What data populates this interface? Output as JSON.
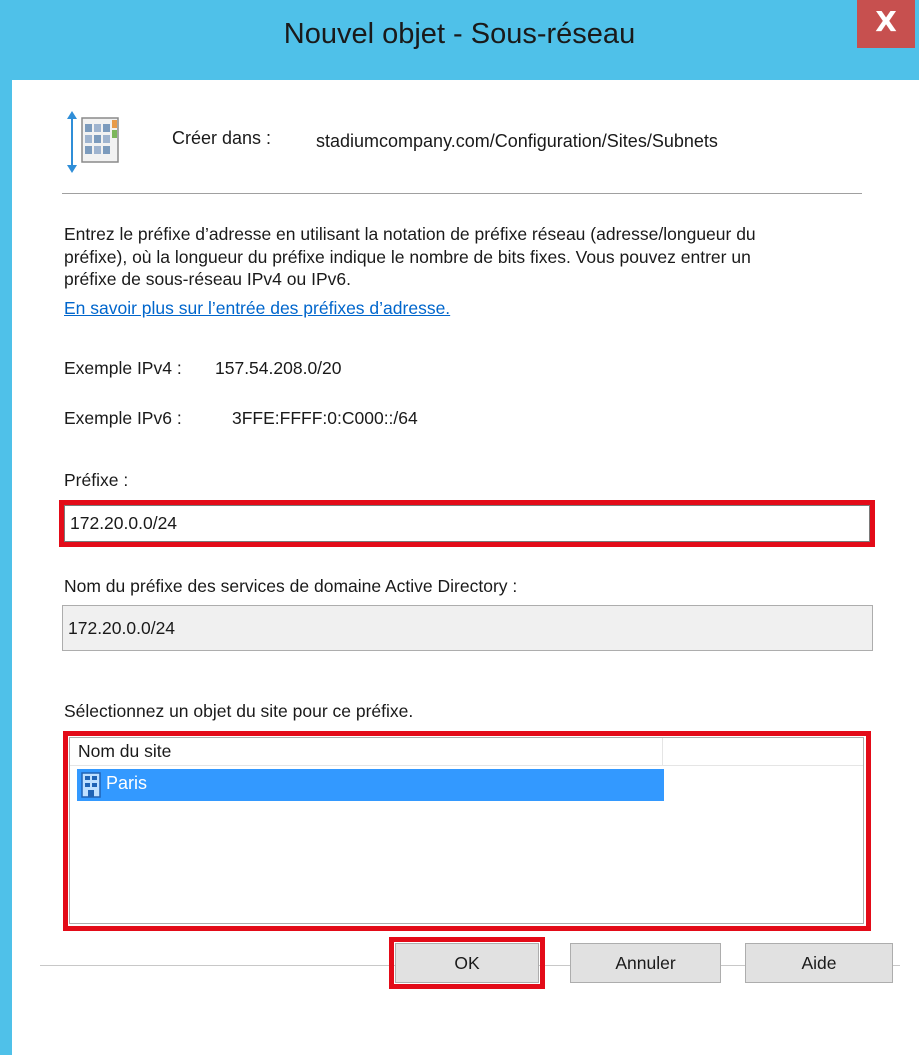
{
  "window": {
    "title": "Nouvel objet - Sous-réseau",
    "close_glyph": "X"
  },
  "header": {
    "icon": "subnet-container-icon",
    "create_label": "Créer dans :",
    "create_path": "stadiumcompany.com/Configuration/Sites/Subnets"
  },
  "description": {
    "text": "Entrez le préfixe d’adresse en utilisant la notation de préfixe réseau (adresse/longueur du préfixe), où la longueur du préfixe indique le nombre de bits fixes. Vous pouvez entrer un préfixe de sous-réseau IPv4 ou IPv6.",
    "link": "En savoir plus sur l’entrée des préfixes d’adresse."
  },
  "examples": {
    "ipv4_label": "Exemple IPv4 :",
    "ipv4_value": "157.54.208.0/20",
    "ipv6_label": "Exemple IPv6 :",
    "ipv6_value": "3FFE:FFFF:0:C000::/64"
  },
  "prefix": {
    "label": "Préfixe :",
    "value": "172.20.0.0/24"
  },
  "ad_prefix": {
    "label": "Nom du préfixe des services de domaine Active Directory :",
    "value": "172.20.0.0/24"
  },
  "site_select": {
    "label": "Sélectionnez un objet du site pour ce préfixe.",
    "column_header": "Nom du site",
    "rows": [
      {
        "icon": "site-icon",
        "name": "Paris",
        "selected": true
      }
    ]
  },
  "buttons": {
    "ok": "OK",
    "cancel": "Annuler",
    "help": "Aide"
  },
  "colors": {
    "titlebar": "#4fc1e9",
    "close_button": "#c7504f",
    "highlight_frame": "#e30b18",
    "selection": "#3399ff",
    "link": "#0066cc"
  }
}
